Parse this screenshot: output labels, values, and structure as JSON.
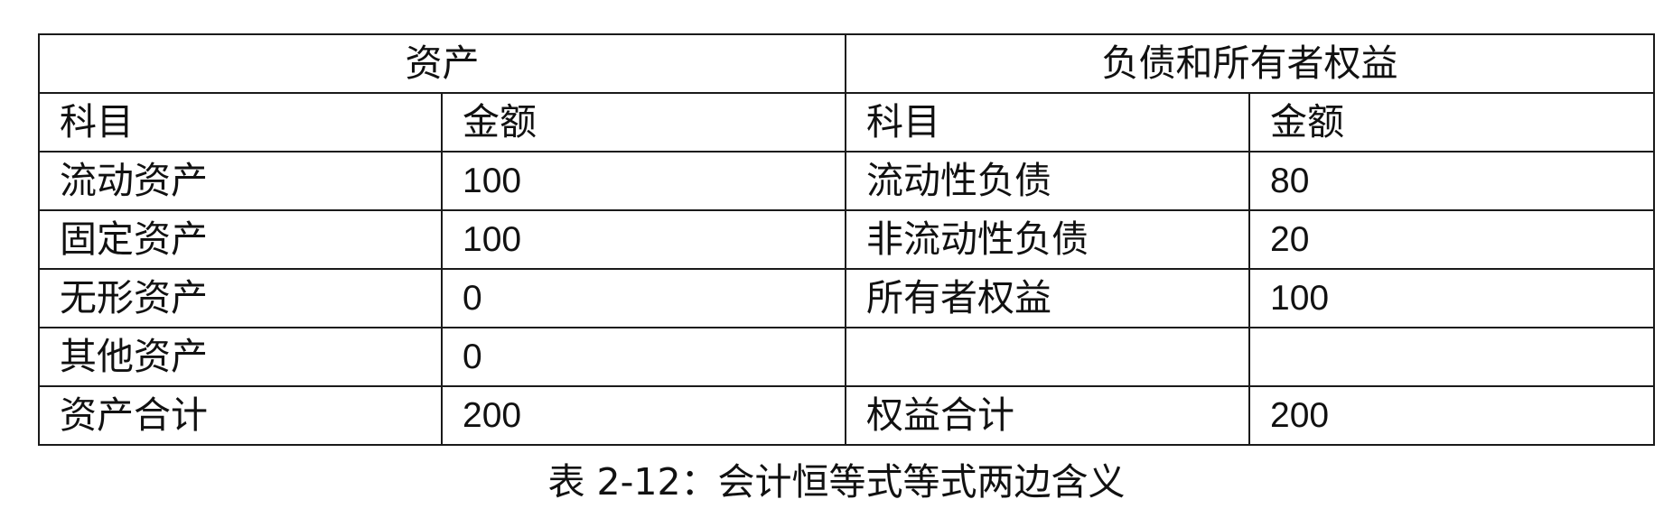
{
  "table": {
    "group_headers": [
      "资产",
      "负债和所有者权益"
    ],
    "column_headers": [
      "科目",
      "金额",
      "科目",
      "金额"
    ],
    "rows": [
      [
        "流动资产",
        "100",
        "流动性负债",
        "80"
      ],
      [
        "固定资产",
        "100",
        "非流动性负债",
        "20"
      ],
      [
        "无形资产",
        "0",
        "所有者权益",
        "100"
      ],
      [
        "其他资产",
        "0",
        "",
        ""
      ],
      [
        "资产合计",
        "200",
        "权益合计",
        "200"
      ]
    ]
  },
  "caption": "表 2-12：会计恒等式等式两边含义"
}
